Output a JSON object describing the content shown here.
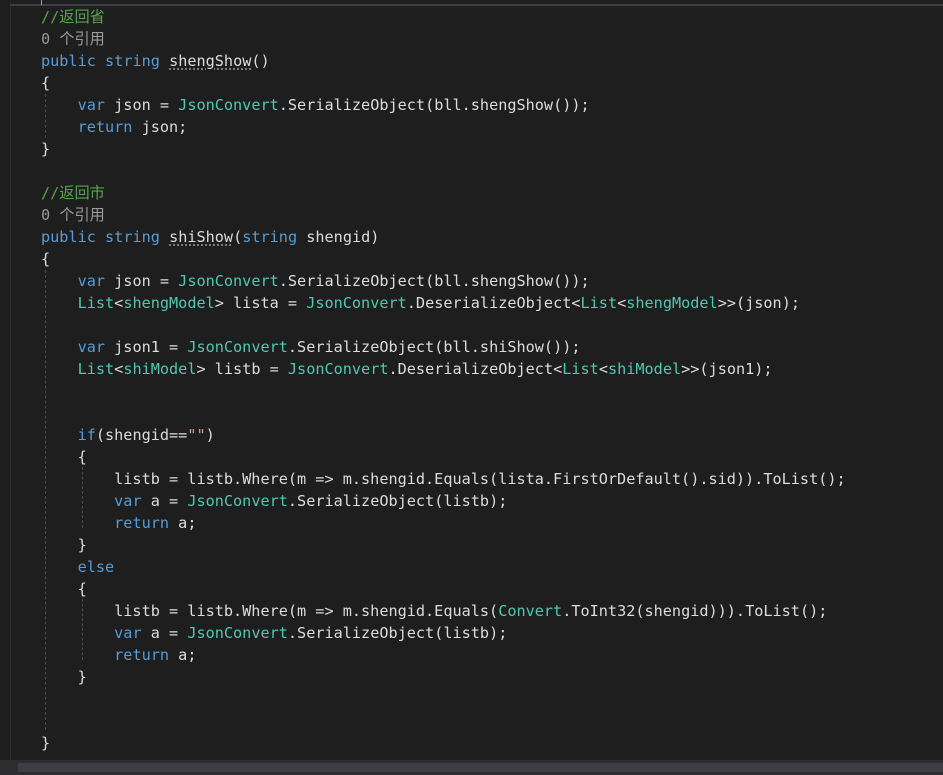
{
  "editor": {
    "colors": {
      "background": "#1e1e1e",
      "keyword": "#569cd6",
      "type": "#4ec9b0",
      "comment": "#57a64a",
      "string": "#d69d85",
      "plain": "#dcdcdc",
      "codelens": "#999999"
    },
    "lines": [
      {
        "tokens": [
          {
            "t": "cm",
            "v": "//返回省"
          }
        ]
      },
      {
        "tokens": [
          {
            "t": "lens",
            "v": "0 个引用"
          }
        ]
      },
      {
        "tokens": [
          {
            "t": "kw",
            "v": "public"
          },
          {
            "t": "p",
            "v": " "
          },
          {
            "t": "kw",
            "v": "string"
          },
          {
            "t": "p",
            "v": " "
          },
          {
            "t": "sq",
            "v": "shengShow"
          },
          {
            "t": "p",
            "v": "()"
          }
        ]
      },
      {
        "tokens": [
          {
            "t": "p",
            "v": "{"
          }
        ]
      },
      {
        "tokens": [
          {
            "t": "p",
            "v": "    "
          },
          {
            "t": "kw",
            "v": "var"
          },
          {
            "t": "p",
            "v": " json = "
          },
          {
            "t": "ty",
            "v": "JsonConvert"
          },
          {
            "t": "p",
            "v": ".SerializeObject(bll.shengShow());"
          }
        ]
      },
      {
        "tokens": [
          {
            "t": "p",
            "v": "    "
          },
          {
            "t": "kw",
            "v": "return"
          },
          {
            "t": "p",
            "v": " json;"
          }
        ]
      },
      {
        "tokens": [
          {
            "t": "p",
            "v": "}"
          }
        ]
      },
      {
        "tokens": []
      },
      {
        "tokens": [
          {
            "t": "cm",
            "v": "//返回市"
          }
        ]
      },
      {
        "tokens": [
          {
            "t": "lens",
            "v": "0 个引用"
          }
        ]
      },
      {
        "tokens": [
          {
            "t": "kw",
            "v": "public"
          },
          {
            "t": "p",
            "v": " "
          },
          {
            "t": "kw",
            "v": "string"
          },
          {
            "t": "p",
            "v": " "
          },
          {
            "t": "sq",
            "v": "shiShow"
          },
          {
            "t": "p",
            "v": "("
          },
          {
            "t": "kw",
            "v": "string"
          },
          {
            "t": "p",
            "v": " shengid)"
          }
        ]
      },
      {
        "tokens": [
          {
            "t": "p",
            "v": "{"
          }
        ]
      },
      {
        "tokens": [
          {
            "t": "p",
            "v": "    "
          },
          {
            "t": "kw",
            "v": "var"
          },
          {
            "t": "p",
            "v": " json = "
          },
          {
            "t": "ty",
            "v": "JsonConvert"
          },
          {
            "t": "p",
            "v": ".SerializeObject(bll.shengShow());"
          }
        ]
      },
      {
        "tokens": [
          {
            "t": "p",
            "v": "    "
          },
          {
            "t": "ty",
            "v": "List"
          },
          {
            "t": "p",
            "v": "<"
          },
          {
            "t": "ty",
            "v": "shengModel"
          },
          {
            "t": "p",
            "v": "> lista = "
          },
          {
            "t": "ty",
            "v": "JsonConvert"
          },
          {
            "t": "p",
            "v": ".DeserializeObject<"
          },
          {
            "t": "ty",
            "v": "List"
          },
          {
            "t": "p",
            "v": "<"
          },
          {
            "t": "ty",
            "v": "shengModel"
          },
          {
            "t": "p",
            "v": ">>(json);"
          }
        ]
      },
      {
        "tokens": []
      },
      {
        "tokens": [
          {
            "t": "p",
            "v": "    "
          },
          {
            "t": "kw",
            "v": "var"
          },
          {
            "t": "p",
            "v": " json1 = "
          },
          {
            "t": "ty",
            "v": "JsonConvert"
          },
          {
            "t": "p",
            "v": ".SerializeObject(bll.shiShow());"
          }
        ]
      },
      {
        "tokens": [
          {
            "t": "p",
            "v": "    "
          },
          {
            "t": "ty",
            "v": "List"
          },
          {
            "t": "p",
            "v": "<"
          },
          {
            "t": "ty",
            "v": "shiModel"
          },
          {
            "t": "p",
            "v": "> listb = "
          },
          {
            "t": "ty",
            "v": "JsonConvert"
          },
          {
            "t": "p",
            "v": ".DeserializeObject<"
          },
          {
            "t": "ty",
            "v": "List"
          },
          {
            "t": "p",
            "v": "<"
          },
          {
            "t": "ty",
            "v": "shiModel"
          },
          {
            "t": "p",
            "v": ">>(json1);"
          }
        ]
      },
      {
        "tokens": []
      },
      {
        "tokens": []
      },
      {
        "tokens": [
          {
            "t": "p",
            "v": "    "
          },
          {
            "t": "kw",
            "v": "if"
          },
          {
            "t": "p",
            "v": "(shengid=="
          },
          {
            "t": "st",
            "v": "\"\""
          },
          {
            "t": "p",
            "v": ")"
          }
        ]
      },
      {
        "tokens": [
          {
            "t": "p",
            "v": "    {"
          }
        ]
      },
      {
        "tokens": [
          {
            "t": "p",
            "v": "        listb = listb.Where(m => m.shengid.Equals(lista.FirstOrDefault().sid)).ToList();"
          }
        ]
      },
      {
        "tokens": [
          {
            "t": "p",
            "v": "        "
          },
          {
            "t": "kw",
            "v": "var"
          },
          {
            "t": "p",
            "v": " a = "
          },
          {
            "t": "ty",
            "v": "JsonConvert"
          },
          {
            "t": "p",
            "v": ".SerializeObject(listb);"
          }
        ]
      },
      {
        "tokens": [
          {
            "t": "p",
            "v": "        "
          },
          {
            "t": "kw",
            "v": "return"
          },
          {
            "t": "p",
            "v": " a;"
          }
        ]
      },
      {
        "tokens": [
          {
            "t": "p",
            "v": "    }"
          }
        ]
      },
      {
        "tokens": [
          {
            "t": "p",
            "v": "    "
          },
          {
            "t": "kw",
            "v": "else"
          }
        ]
      },
      {
        "tokens": [
          {
            "t": "p",
            "v": "    {"
          }
        ]
      },
      {
        "tokens": [
          {
            "t": "p",
            "v": "        listb = listb.Where(m => m.shengid.Equals("
          },
          {
            "t": "ty",
            "v": "Convert"
          },
          {
            "t": "p",
            "v": ".ToInt32(shengid))).ToList();"
          }
        ]
      },
      {
        "tokens": [
          {
            "t": "p",
            "v": "        "
          },
          {
            "t": "kw",
            "v": "var"
          },
          {
            "t": "p",
            "v": " a = "
          },
          {
            "t": "ty",
            "v": "JsonConvert"
          },
          {
            "t": "p",
            "v": ".SerializeObject(listb);"
          }
        ]
      },
      {
        "tokens": [
          {
            "t": "p",
            "v": "        "
          },
          {
            "t": "kw",
            "v": "return"
          },
          {
            "t": "p",
            "v": " a;"
          }
        ]
      },
      {
        "tokens": [
          {
            "t": "p",
            "v": "    }"
          }
        ]
      },
      {
        "tokens": []
      },
      {
        "tokens": []
      },
      {
        "tokens": [
          {
            "t": "p",
            "v": "}"
          }
        ]
      }
    ]
  }
}
